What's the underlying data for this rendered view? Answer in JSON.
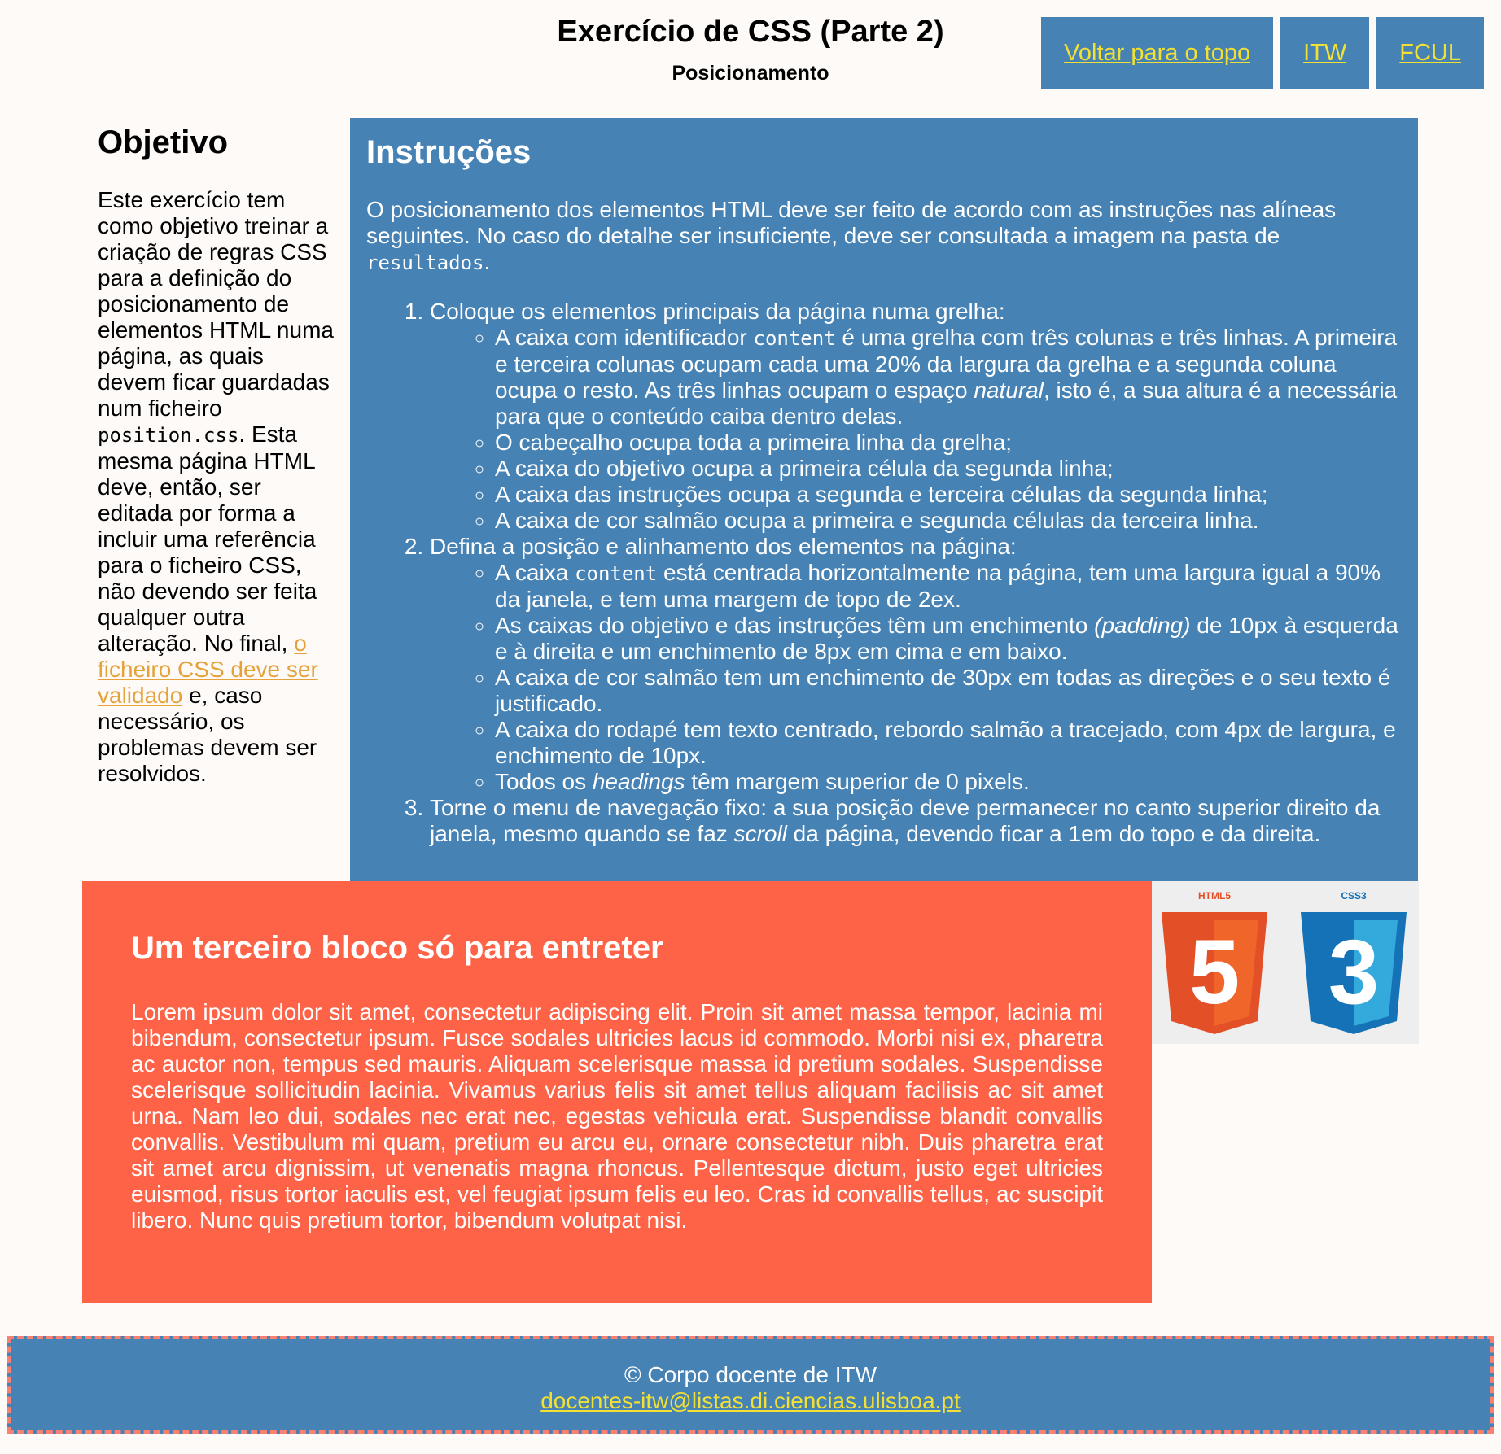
{
  "header": {
    "title": "Exercício de CSS (Parte 2)",
    "subtitle": "Posicionamento"
  },
  "nav": {
    "items": [
      "Voltar para o topo",
      "ITW",
      "FCUL"
    ],
    "background": "#4682b4",
    "link_color": "#f2e033"
  },
  "objetivo": {
    "heading": "Objetivo",
    "text_before_code": "Este exercício tem como objetivo treinar a criação de regras CSS para a definição do posicionamento de elementos HTML numa página, as quais devem ficar guardadas num ficheiro ",
    "code": "position.css",
    "text_after_code": ". Esta mesma página HTML deve, então, ser editada por forma a incluir uma referência para o ficheiro CSS, não devendo ser feita qualquer outra alteração. No final, ",
    "link": "o ficheiro CSS deve ser validado",
    "text_end": " e, caso necessário, os problemas devem ser resolvidos."
  },
  "instrucoes": {
    "heading": "Instruções",
    "intro_before_code": "O posicionamento dos elementos HTML deve ser feito de acordo com as instruções nas alíneas seguintes. No caso do detalhe ser insuficiente, deve ser consultada a imagem na pasta de ",
    "intro_code": "resultados",
    "intro_after_code": ".",
    "item1": "Coloque os elementos principais da página numa grelha:",
    "item1_sub1_a": "A caixa com identificador ",
    "item1_sub1_code": "content",
    "item1_sub1_b": " é uma grelha com três colunas e três linhas. A primeira e terceira colunas ocupam cada uma 20% da largura da grelha e a segunda coluna ocupa o resto. As três linhas ocupam o espaço ",
    "item1_sub1_em": "natural",
    "item1_sub1_c": ", isto é, a sua altura é a necessária para que o conteúdo caiba dentro delas.",
    "item1_sub2": "O cabeçalho ocupa toda a primeira linha da grelha;",
    "item1_sub3": "A caixa do objetivo ocupa a primeira célula da segunda linha;",
    "item1_sub4": "A caixa das instruções ocupa a segunda e terceira células da segunda linha;",
    "item1_sub5": "A caixa de cor salmão ocupa a primeira e segunda células da terceira linha.",
    "item2": "Defina a posição e alinhamento dos elementos na página:",
    "item2_sub1_a": "A caixa ",
    "item2_sub1_code": "content",
    "item2_sub1_b": " está centrada horizontalmente na página, tem uma largura igual a 90% da janela, e tem uma margem de topo de 2ex.",
    "item2_sub2_a": "As caixas do objetivo e das instruções têm um enchimento ",
    "item2_sub2_em": "(padding)",
    "item2_sub2_b": " de 10px à esquerda e à direita e um enchimento de 8px em cima e em baixo.",
    "item2_sub3": "A caixa de cor salmão tem um enchimento de 30px em todas as direções e o seu texto é justificado.",
    "item2_sub4": "A caixa do rodapé tem texto centrado, rebordo salmão a tracejado, com 4px de largura, e enchimento de 10px.",
    "item2_sub5_a": "Todos os ",
    "item2_sub5_em": "headings",
    "item2_sub5_b": " têm margem superior de 0 pixels.",
    "item3_a": "Torne o menu de navegação fixo: a sua posição deve permanecer no canto superior direito da janela, mesmo quando se faz ",
    "item3_em": "scroll",
    "item3_b": " da página, devendo ficar a 1em do topo e da direita."
  },
  "salmao": {
    "heading": "Um terceiro bloco só para entreter",
    "text": "Lorem ipsum dolor sit amet, consectetur adipiscing elit. Proin sit amet massa tempor, lacinia mi bibendum, consectetur ipsum. Fusce sodales ultricies lacus id commodo. Morbi nisi ex, pharetra ac auctor non, tempus sed mauris. Aliquam scelerisque massa id pretium sodales. Suspendisse scelerisque sollicitudin lacinia. Vivamus varius felis sit amet tellus aliquam facilisis ac sit amet urna. Nam leo dui, sodales nec erat nec, egestas vehicula erat. Suspendisse blandit convallis convallis. Vestibulum mi quam, pretium eu arcu eu, ornare consectetur nibh. Duis pharetra erat sit amet arcu dignissim, ut venenatis magna rhoncus. Pellentesque dictum, justo eget ultricies euismod, risus tortor iaculis est, vel feugiat ipsum felis eu leo. Cras id convallis tellus, ac suscipit libero. Nunc quis pretium tortor, bibendum volutpat nisi.",
    "background": "#ff6347"
  },
  "logos": {
    "html_label": "HTML5",
    "html_digit": "5",
    "css_label": "CSS3",
    "css_digit": "3",
    "html_icon": "html5-logo-icon",
    "css_icon": "css3-logo-icon"
  },
  "footer": {
    "copyright": "© Corpo docente de ITW",
    "email": "docentes-itw@listas.di.ciencias.ulisboa.pt",
    "border_color": "#fa8072"
  }
}
